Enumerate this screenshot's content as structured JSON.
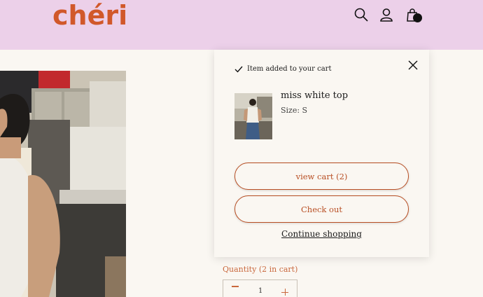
{
  "header": {
    "logo": "chéri",
    "icons": [
      "search-icon",
      "account-icon",
      "cart-icon"
    ],
    "background": "#ecd0e9",
    "logo_color": "#d1582a"
  },
  "cart_popup": {
    "added_message": "Item added to your cart",
    "product_name": "miss white top",
    "product_size": "Size: S",
    "view_cart_label": "view cart (2)",
    "checkout_label": "Check out",
    "continue_label": "Continue shopping",
    "accent_color": "#b84e23"
  },
  "product": {
    "quantity_label": "Quantity (2 in cart)",
    "quantity_value": "1"
  }
}
